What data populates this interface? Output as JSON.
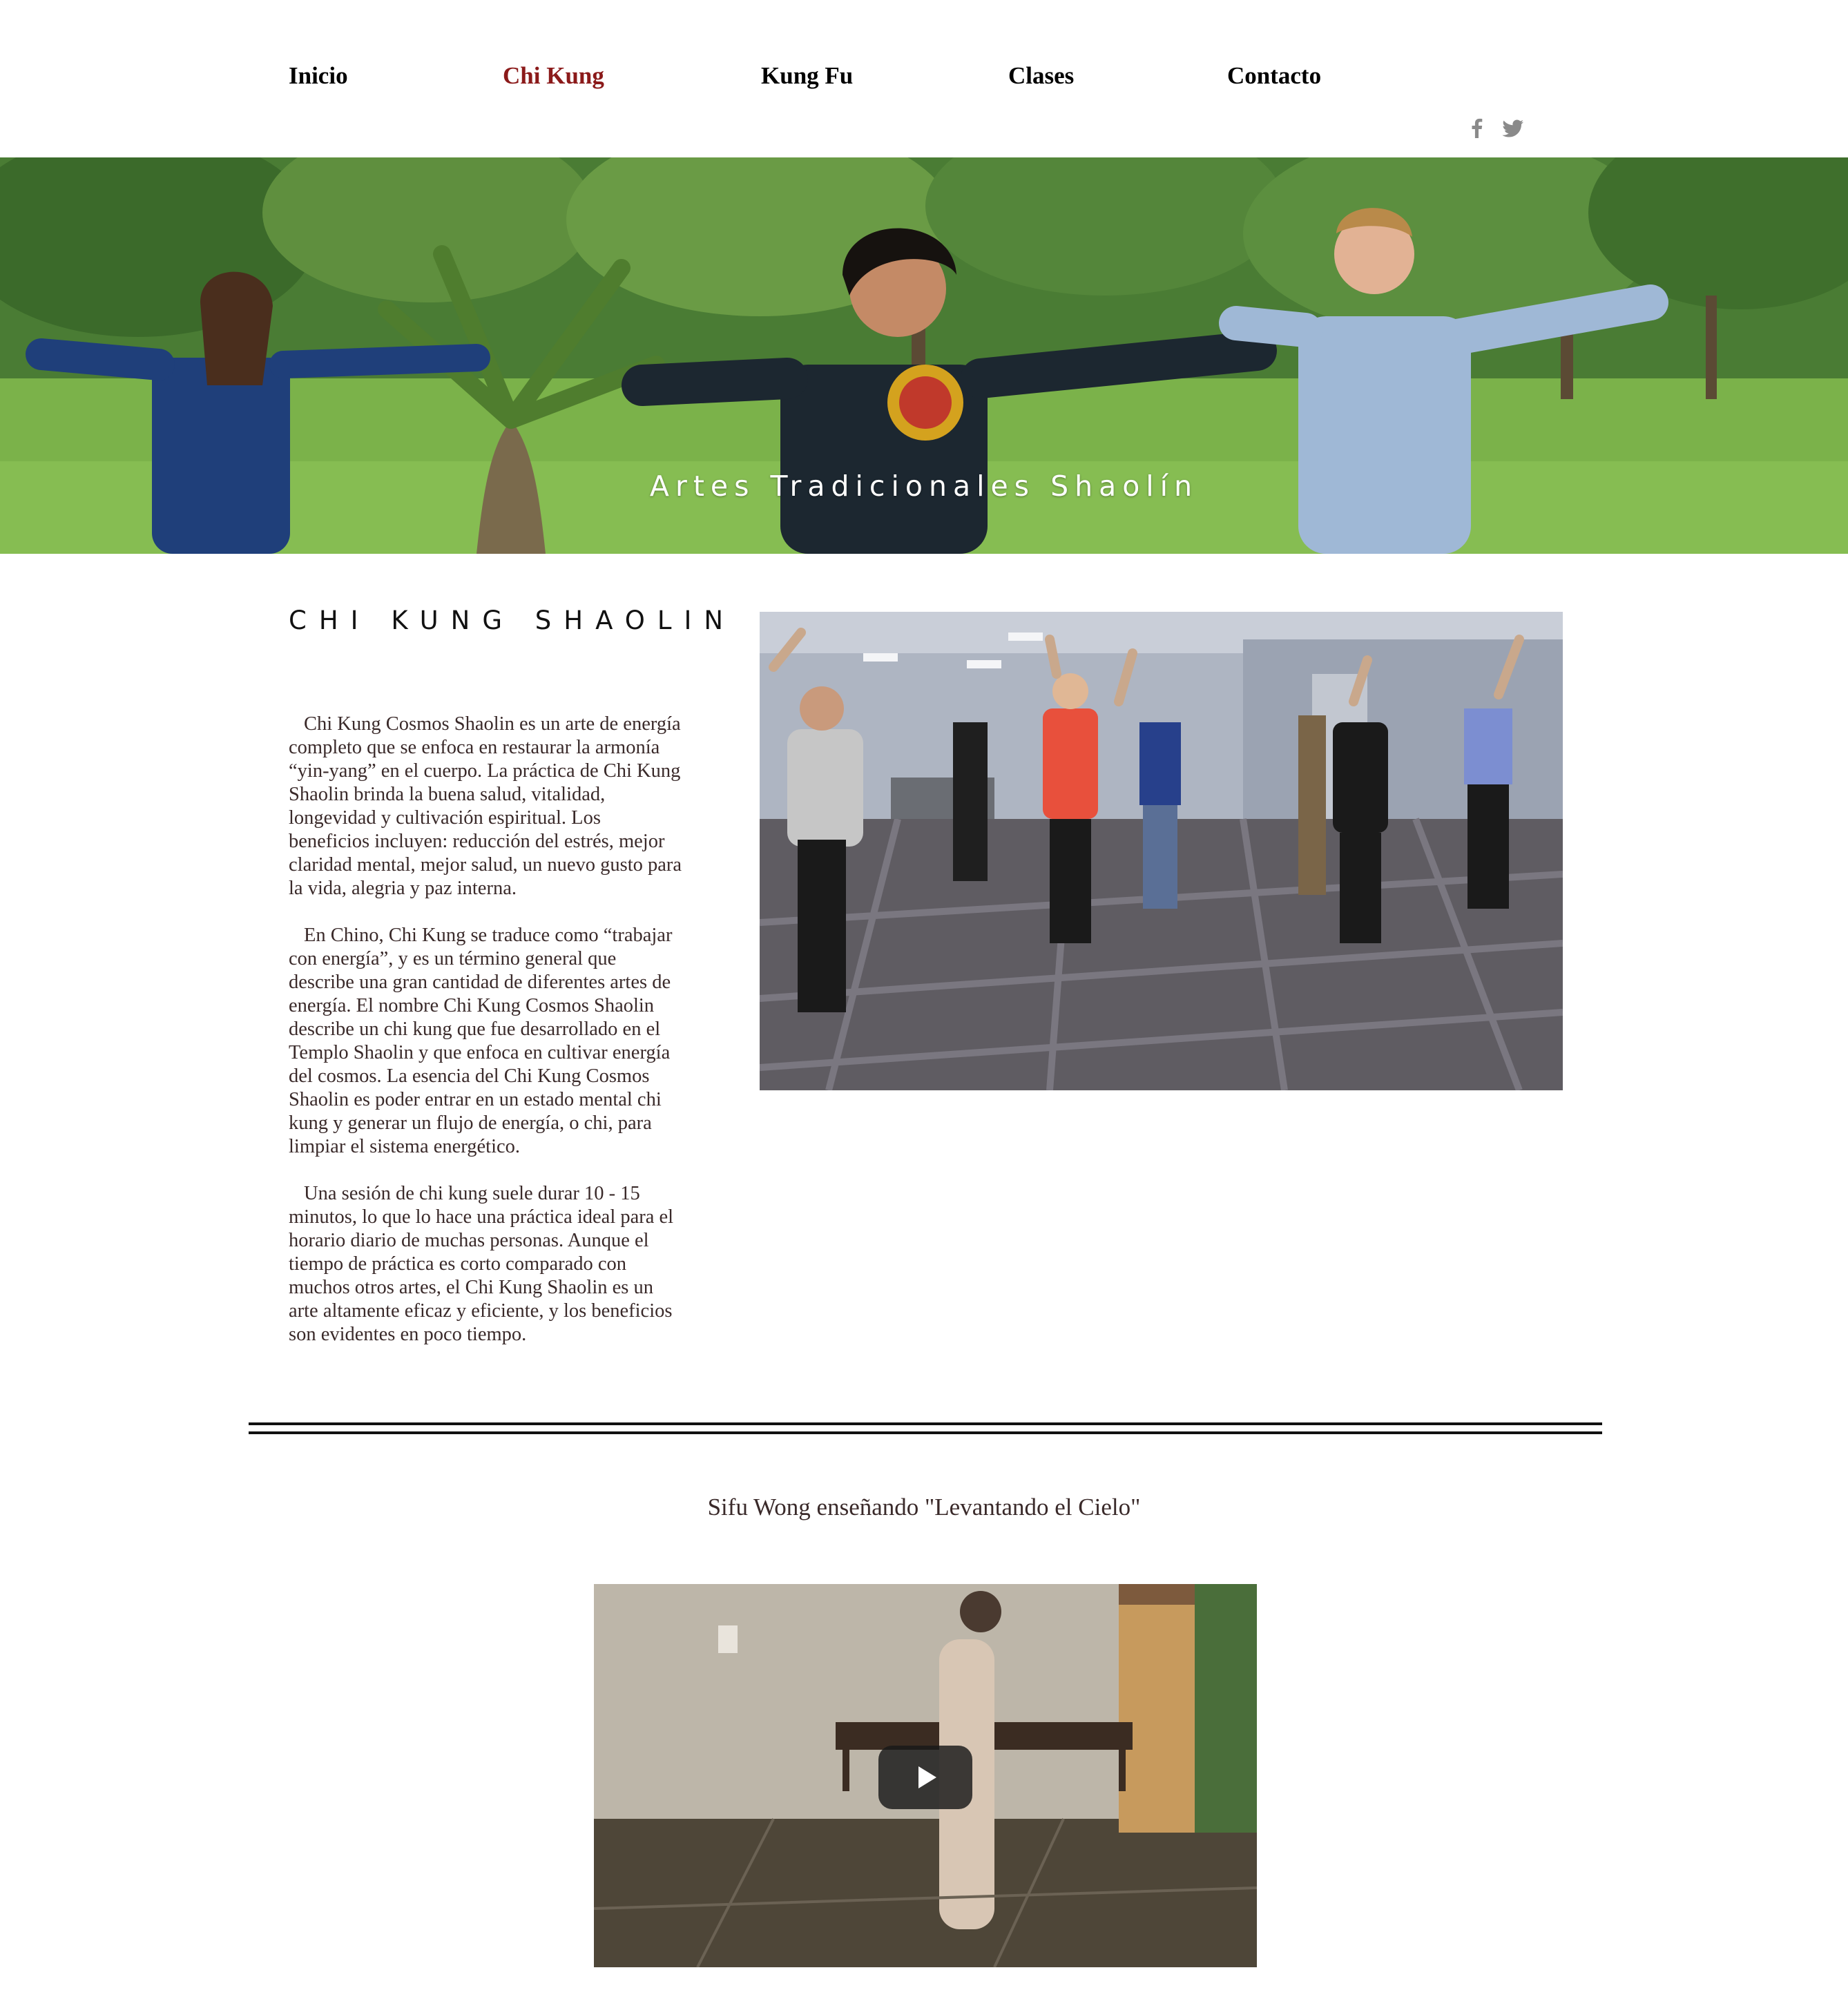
{
  "nav": {
    "items": [
      {
        "label": "Inicio",
        "active": false
      },
      {
        "label": "Chi Kung",
        "active": true
      },
      {
        "label": "Kung Fu",
        "active": false
      },
      {
        "label": "Clases",
        "active": false
      },
      {
        "label": "Contacto",
        "active": false
      }
    ],
    "active_color": "#8b1a1a",
    "social": [
      {
        "icon": "facebook-icon"
      },
      {
        "icon": "twitter-icon"
      }
    ]
  },
  "hero": {
    "title": "Artes Tradicionales Shaolín"
  },
  "main": {
    "section_title": "CHI KUNG SHAOLIN",
    "paragraphs": [
      "Chi Kung Cosmos Shaolin es un arte de energía completo que se enfoca en restaurar la armonía “yin-yang” en el cuerpo.  La práctica de Chi Kung Shaolin brinda la buena salud, vitalidad, longevidad y cultivación espiritual.  Los beneficios incluyen: reducción del estrés, mejor claridad mental, mejor salud, un nuevo gusto para la vida, alegria y paz interna.",
      "En Chino, Chi Kung se traduce como “trabajar con energía”, y es un término general que describe una gran cantidad de diferentes artes de energía.  El nombre Chi Kung Cosmos Shaolin describe un chi kung que fue desarrollado en el Templo Shaolin y que enfoca en cultivar energía del cosmos.  La esencia del Chi Kung Cosmos Shaolin es poder entrar en un estado mental chi kung y generar un flujo de energía, o chi, para limpiar el sistema energético.",
      "Una sesión de chi kung suele durar 10 - 15 minutos, lo que lo hace una práctica ideal para el horario diario de muchas personas.  Aunque el tiempo de práctica es corto comparado con muchos otros artes, el Chi Kung Shaolin es un arte altamente eficaz y eficiente, y los beneficios son evidentes en poco tiempo."
    ]
  },
  "video": {
    "caption": "Sifu Wong enseñando \"Levantando el Cielo\""
  }
}
